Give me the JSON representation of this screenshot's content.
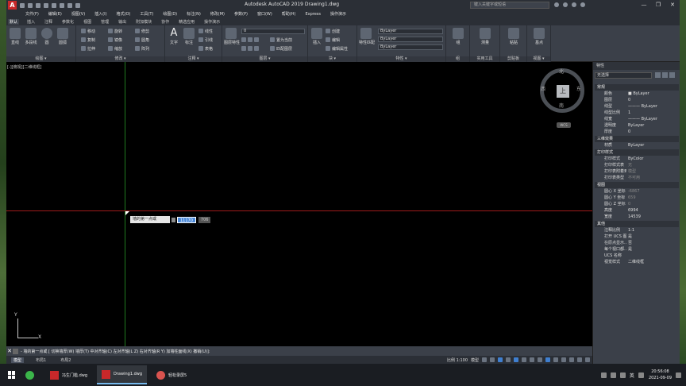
{
  "app": {
    "title": "Autodesk AutoCAD 2019    Drawing1.dwg",
    "search_placeholder": "键入关键字或短语",
    "window_controls": [
      "—",
      "❐",
      "✕"
    ]
  },
  "menubar": [
    "文件(F)",
    "编辑(E)",
    "视图(V)",
    "插入(I)",
    "格式(O)",
    "工具(T)",
    "绘图(D)",
    "标注(N)",
    "修改(M)",
    "参数(P)",
    "窗口(W)",
    "帮助(H)",
    "Express",
    "操作演示"
  ],
  "ribbon_tabs": [
    "默认",
    "插入",
    "注释",
    "参数化",
    "视图",
    "管理",
    "输出",
    "附加模块",
    "协作",
    "精选应用",
    "操作演示"
  ],
  "ribbon": {
    "draw": {
      "title": "绘图 ▾",
      "big": [
        "直线",
        "多段线",
        "圆",
        "圆弧"
      ]
    },
    "modify": {
      "title": "修改 ▾",
      "tools": [
        "移动",
        "旋转",
        "修剪",
        "复制",
        "镜像",
        "圆角",
        "拉伸",
        "缩放",
        "阵列"
      ]
    },
    "annotation": {
      "title": "注释 ▾",
      "big": [
        "文字",
        "标注"
      ],
      "tools": [
        "线性",
        "引线",
        "表格"
      ]
    },
    "layers": {
      "title": "图层 ▾",
      "big": [
        "图层特性"
      ],
      "combo": "0",
      "tools": [
        "置为当前",
        "匹配图层"
      ]
    },
    "block": {
      "title": "块 ▾",
      "big": [
        "插入"
      ],
      "tools": [
        "创建",
        "编辑",
        "编辑属性"
      ]
    },
    "properties": {
      "title": "特性 ▾",
      "big": [
        "特性匹配"
      ],
      "combos": [
        "ByLayer",
        "ByLayer",
        "ByLayer"
      ]
    },
    "groups": {
      "title": "组",
      "big": [
        "组"
      ]
    },
    "utilities": {
      "title": "实用工具",
      "big": [
        "测量"
      ]
    },
    "clipboard": {
      "title": "剪贴板",
      "big": [
        "粘贴"
      ]
    },
    "view": {
      "title": "视图 ▾",
      "big": [
        "基点"
      ]
    }
  },
  "viewport": {
    "label": "[-][俯视][二维线框]",
    "viewcube": {
      "top_face": "上",
      "north": "北",
      "south": "南",
      "east": "东",
      "west": "西",
      "wcs": "WCS"
    },
    "ucs_x": "X",
    "ucs_y": "Y",
    "tooltip": {
      "prompt": "墙的第一点或",
      "value": "11170",
      "value2": "706"
    }
  },
  "command_line": {
    "text": "- 墙的第一点或 [ 切换墙厚(W) 墙厚(T) 中对齐轴(C) 左对齐轴(L Z) 右对齐轴(R Y) 加墙柱面线(X) 撤销(U)]:"
  },
  "layout_tabs": [
    "模型",
    "布局1",
    "布局2"
  ],
  "statusbar": {
    "scale": "比例 1:100",
    "model": "模型"
  },
  "properties_palette": {
    "title": "特性",
    "selection": "无选择",
    "sections": [
      {
        "name": "常规",
        "rows": [
          {
            "k": "颜色",
            "v": "■ ByLayer"
          },
          {
            "k": "图层",
            "v": "0"
          },
          {
            "k": "线型",
            "v": "——— ByLayer"
          },
          {
            "k": "线型比例",
            "v": "1"
          },
          {
            "k": "线宽",
            "v": "——— ByLayer"
          },
          {
            "k": "透明度",
            "v": "ByLayer"
          },
          {
            "k": "厚度",
            "v": "0"
          }
        ]
      },
      {
        "name": "三维效果",
        "rows": [
          {
            "k": "材质",
            "v": "ByLayer"
          }
        ]
      },
      {
        "name": "打印样式",
        "rows": [
          {
            "k": "打印样式",
            "v": "ByColor"
          },
          {
            "k": "打印样式表",
            "v": "无"
          },
          {
            "k": "打印表附着到",
            "v": "模型"
          },
          {
            "k": "打印表类型",
            "v": "不可用"
          }
        ]
      },
      {
        "name": "视图",
        "rows": [
          {
            "k": "圆心 X 坐标",
            "v": "-6867"
          },
          {
            "k": "圆心 Y 坐标",
            "v": "659"
          },
          {
            "k": "圆心 Z 坐标",
            "v": "0"
          },
          {
            "k": "高度",
            "v": "6994"
          },
          {
            "k": "宽度",
            "v": "14539"
          }
        ]
      },
      {
        "name": "其他",
        "rows": [
          {
            "k": "注释比例",
            "v": "1:1"
          },
          {
            "k": "打开 UCS 图标",
            "v": "是"
          },
          {
            "k": "在原点显示...",
            "v": "否"
          },
          {
            "k": "每个视口都...",
            "v": "是"
          },
          {
            "k": "UCS 名称",
            "v": ""
          },
          {
            "k": "视觉样式",
            "v": "二维线框"
          }
        ]
      }
    ]
  },
  "taskbar": {
    "apps": [
      {
        "label": "冯生门槛.dwg",
        "color": "#c8282a"
      },
      {
        "label": "Drawing1.dwg",
        "color": "#c8282a"
      },
      {
        "label": "轻松录屏5",
        "color": "#d9534f"
      }
    ],
    "lang": "英",
    "time": "20:56:08",
    "date": "2021-09-09"
  }
}
